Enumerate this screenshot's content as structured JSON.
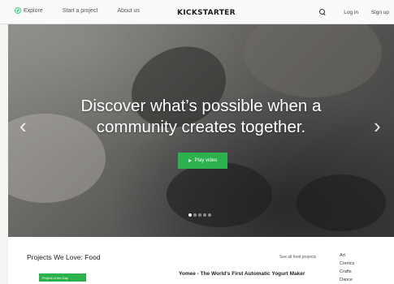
{
  "nav": {
    "explore": "Explore",
    "start_project": "Start a project",
    "about": "About us",
    "logo": "KICKSTARTER",
    "login": "Log in",
    "signup": "Sign up"
  },
  "hero": {
    "title_line1": "Discover what’s possible when a",
    "title_line2": "community creates together.",
    "play_label": "Play video",
    "arrow_left": "‹",
    "arrow_right": "›",
    "slide_count": 5,
    "active_slide": 1
  },
  "projects": {
    "title": "Projects We Love: Food",
    "see_all": "See all food projects",
    "featured_badge": "Project of the Day",
    "featured_name": "Yomee - The World's First Automatic Yogurt Maker",
    "categories": [
      "Art",
      "Comics",
      "Crafts",
      "Dance"
    ]
  },
  "colors": {
    "accent_green": "#2bb24c",
    "brand_green": "#2bde73",
    "hero_text": "#ffffff"
  },
  "icons": {
    "explore": "compass-icon",
    "search": "search-icon",
    "play": "play-icon"
  }
}
